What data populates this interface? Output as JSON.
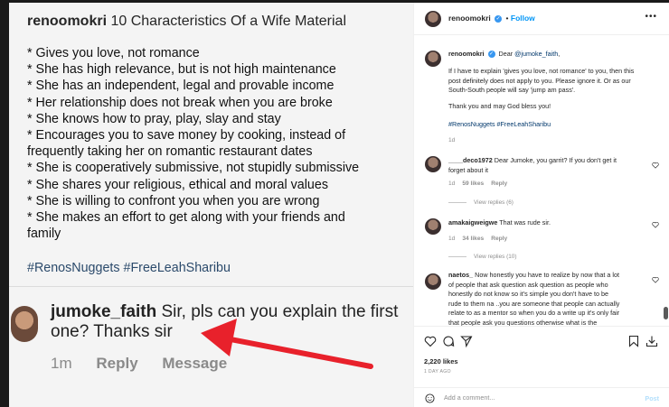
{
  "post_image": {
    "header_handle": "renoomokri",
    "header_title": "10 Characteristics Of a Wife Material",
    "items": [
      "* Gives you love, not romance",
      "* She has high relevance, but is not high maintenance",
      "* She has an independent, legal and provable income",
      "* Her relationship does not break when you are broke",
      "* She knows how to pray, play, slay and stay",
      "* Encourages you to save money by cooking, instead of",
      "frequently taking her on romantic restaurant dates",
      "* She is cooperatively submissive, not stupidly submissive",
      "* She shares your religious, ethical and moral values",
      "* She is willing to confront you when you are wrong",
      "* She makes an effort to get along with your friends and",
      "family"
    ],
    "tags": "#RenosNuggets #FreeLeahSharibu",
    "reply": {
      "handle": "jumoke_faith",
      "text_line1": "Sir, pls can you explain the first",
      "text_line2": "one? Thanks sir",
      "time": "1m",
      "reply_label": "Reply",
      "message_label": "Message"
    },
    "arrow_color": "#e8212b"
  },
  "panel": {
    "header": {
      "username": "renoomokri",
      "separator": "•",
      "follow_label": "Follow",
      "more_icon": "more-horizontal-icon"
    },
    "caption": {
      "username": "renoomokri",
      "intro": "Dear",
      "mention": "@jumoke_faith",
      "intro_end": ",",
      "paragraph1_lines": [
        "If I have to explain 'gives you love, not romance' to you, then this",
        "post definitely does not apply to you. Please ignore it. Or as our",
        "South-South people will say 'jump am pass'."
      ],
      "paragraph2": "Thank you and may God bless you!",
      "hashtags": "#RenosNuggets #FreeLeahSharibu",
      "time": "1d"
    },
    "comments": [
      {
        "username": "____deco1972",
        "text_line1": "Dear Jumoke, you garrit? If you don't get it",
        "text_line2": "forget about it",
        "time": "1d",
        "likes": "59 likes",
        "reply_label": "Reply",
        "view_replies": "View replies (6)"
      },
      {
        "username": "amakaigweigwe",
        "text_line1": "That was rude sir.",
        "time": "1d",
        "likes": "34 likes",
        "reply_label": "Reply",
        "view_replies": "View replies (10)"
      },
      {
        "username": "naetos_",
        "text_lines": [
          "Now honestly you have to realize by now that a lot",
          "of people that ask question ask question as people who",
          "honestly do not know so it's simple you don't have to be",
          "rude to them na ..you are someone that people can actually",
          "relate to as a mentor so when you do a write up it's only fair",
          "that people ask you questions otherwise what is the"
        ]
      }
    ],
    "likes_count": "2,220 likes",
    "age": "1 DAY AGO",
    "add_comment_placeholder": "Add a comment...",
    "post_label": "Post",
    "colors": {
      "link": "#00376b",
      "follow": "#0095f6",
      "post_disabled": "#b2dffc",
      "muted": "#8e8e8e"
    }
  }
}
